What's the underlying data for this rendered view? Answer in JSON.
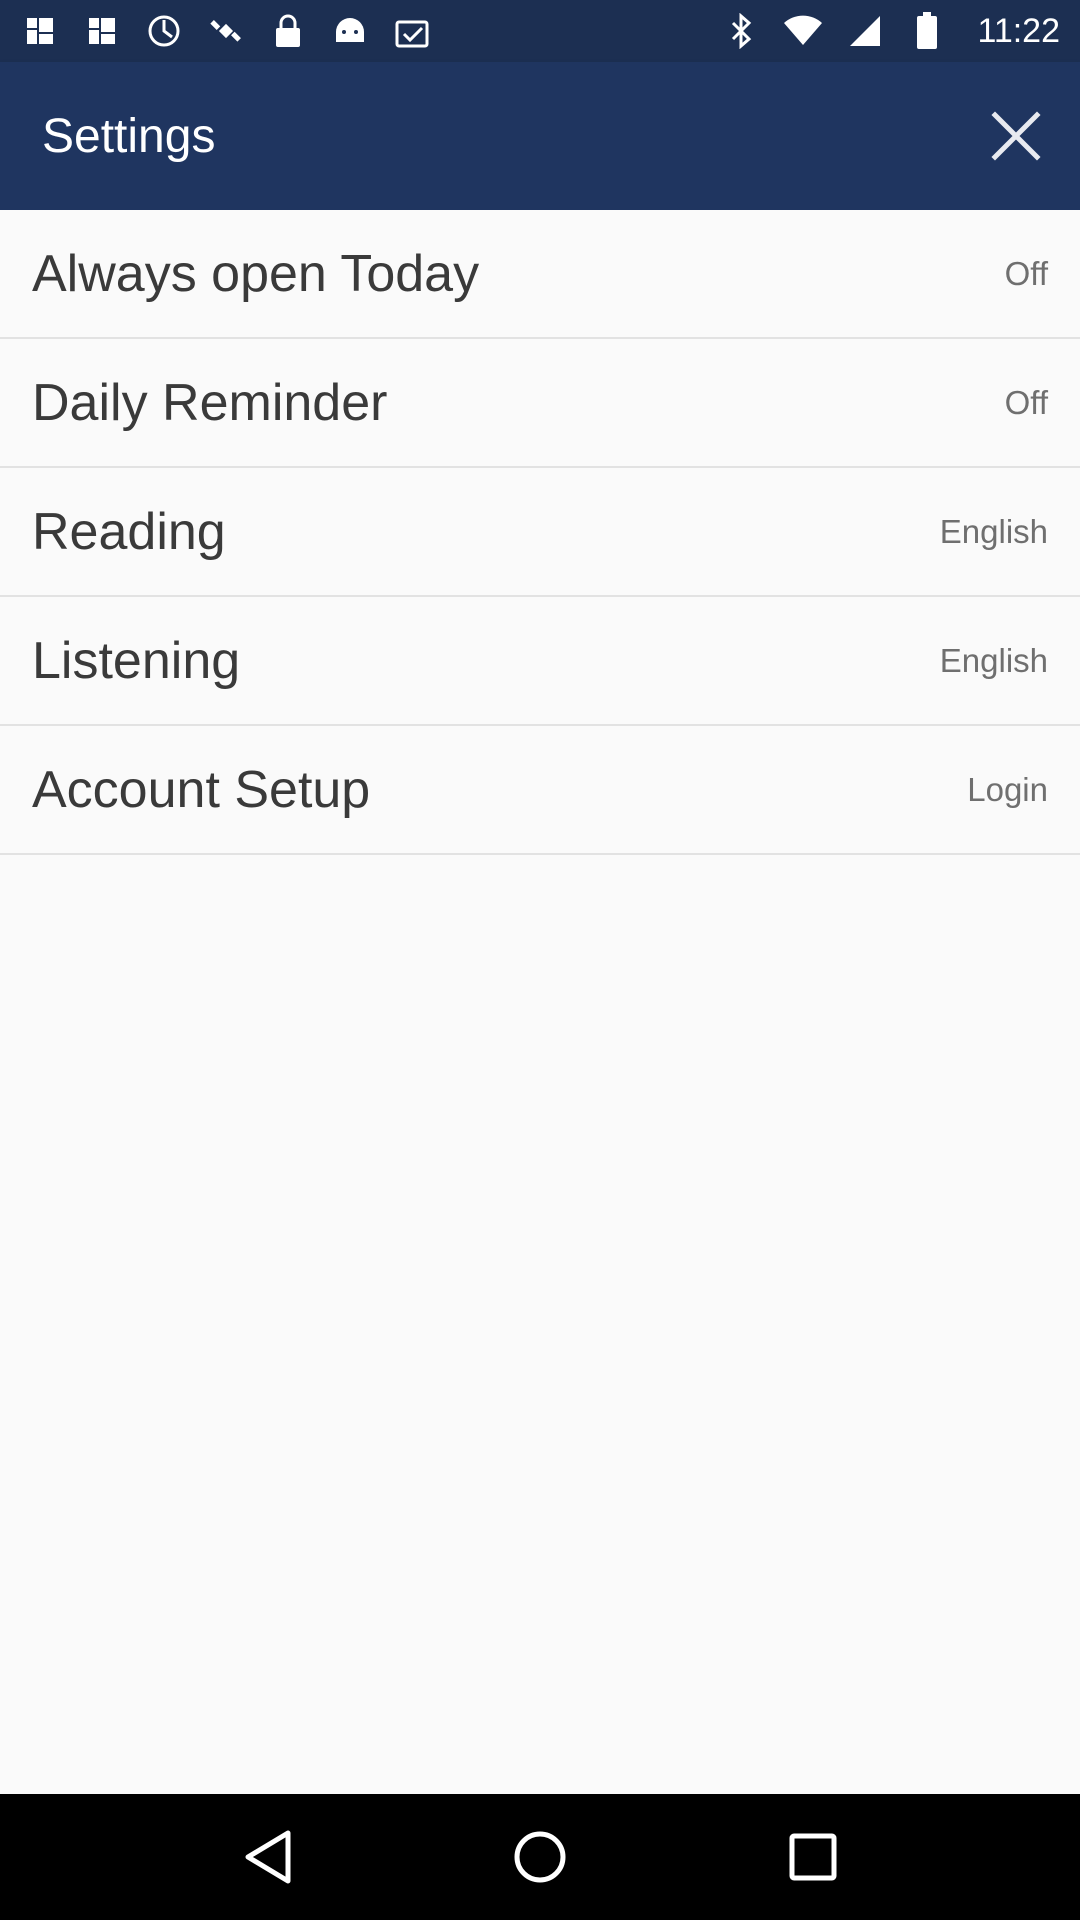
{
  "status_bar": {
    "time": "11:22",
    "left_icons": [
      "app-notification-icon",
      "app-notification-icon",
      "pinwheel-icon",
      "gps-icon",
      "lock-icon",
      "android-icon",
      "checked-clipboard-icon"
    ],
    "right_icons": [
      "bluetooth-icon",
      "wifi-icon",
      "signal-icon",
      "battery-icon"
    ]
  },
  "header": {
    "title": "Settings",
    "close_icon": "close-icon"
  },
  "settings": {
    "items": [
      {
        "label": "Always open Today",
        "value": "Off"
      },
      {
        "label": "Daily Reminder",
        "value": "Off"
      },
      {
        "label": "Reading",
        "value": "English"
      },
      {
        "label": "Listening",
        "value": "English"
      },
      {
        "label": "Account Setup",
        "value": "Login"
      }
    ]
  },
  "nav_bar": {
    "buttons": [
      "back-icon",
      "home-icon",
      "recents-icon"
    ]
  },
  "colors": {
    "header_bg": "#1f3560",
    "status_bg": "#1c2f52",
    "page_bg": "#fafafa",
    "divider": "#e2e2e2"
  }
}
